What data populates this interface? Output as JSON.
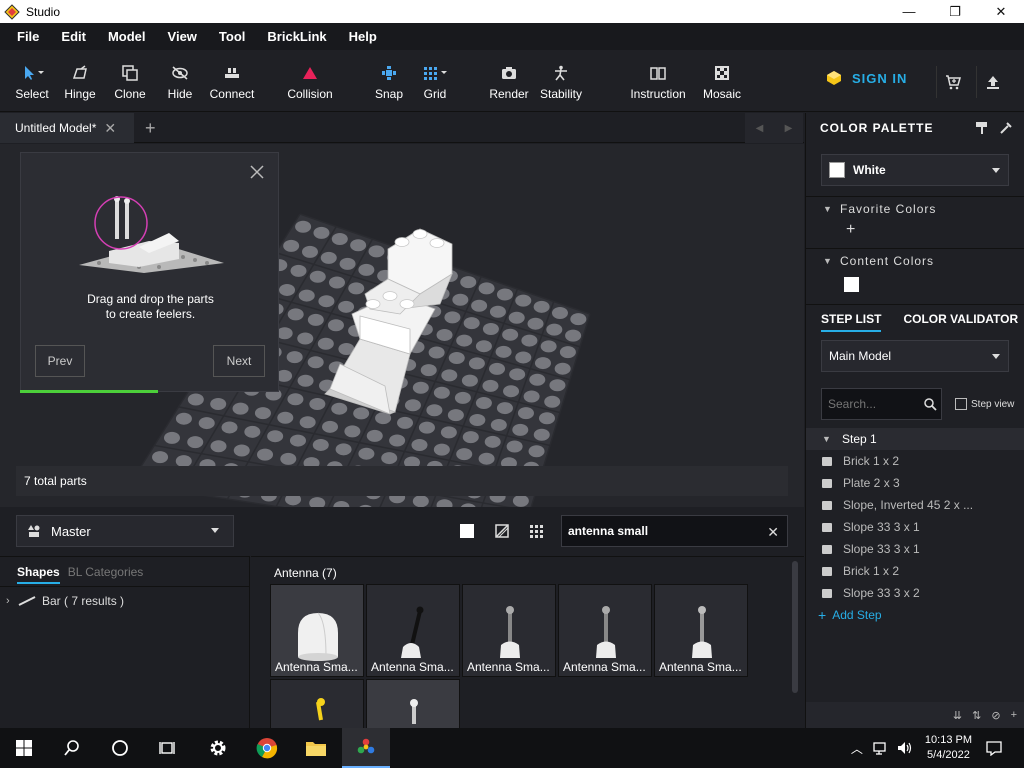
{
  "window": {
    "title": "Studio",
    "minimize": "—",
    "maximize": "❐",
    "close": "✕"
  },
  "menu": [
    "File",
    "Edit",
    "Model",
    "View",
    "Tool",
    "BrickLink",
    "Help"
  ],
  "toolbar": {
    "select": "Select",
    "hinge": "Hinge",
    "clone": "Clone",
    "hide": "Hide",
    "connect": "Connect",
    "collision": "Collision",
    "snap": "Snap",
    "grid": "Grid",
    "render": "Render",
    "stability": "Stability",
    "instruction": "Instruction",
    "mosaic": "Mosaic",
    "sign_in": "SIGN IN"
  },
  "tabs": {
    "active": "Untitled Model*",
    "close": "✕",
    "add": "+"
  },
  "tutorial": {
    "line1": "Drag and drop the parts",
    "line2": "to create feelers.",
    "prev": "Prev",
    "next": "Next",
    "progress": 0.5
  },
  "viewport": {
    "total_parts": "7 total parts"
  },
  "parts": {
    "palette_name": "Master",
    "search_value": "antenna small",
    "clear": "✕",
    "category_tabs": [
      "Shapes",
      "BL Categories"
    ],
    "category_row": "Bar ( 7 results )",
    "group_title": "Antenna (7)",
    "items": [
      "Antenna Sma...",
      "Antenna Sma...",
      "Antenna Sma...",
      "Antenna Sma...",
      "Antenna Sma..."
    ]
  },
  "colors": {
    "header": "COLOR PALETTE",
    "selected": "White",
    "favorite": "Favorite Colors",
    "add": "+",
    "content": "Content Colors",
    "accent": "#27aee6"
  },
  "steps": {
    "tab_step_list": "STEP LIST",
    "tab_validator": "COLOR VALIDATOR",
    "model": "Main Model",
    "search_placeholder": "Search...",
    "step_view": "Step view",
    "step1": "Step 1",
    "parts": [
      "Brick 1 x 2",
      "Plate 2 x 3",
      "Slope, Inverted 45 2 x ...",
      "Slope 33 3 x 1",
      "Slope 33 3 x 1",
      "Brick 1 x 2",
      "Slope 33 3 x 2"
    ],
    "add_step": "Add Step"
  },
  "taskbar": {
    "time": "10:13 PM",
    "date": "5/4/2022"
  }
}
